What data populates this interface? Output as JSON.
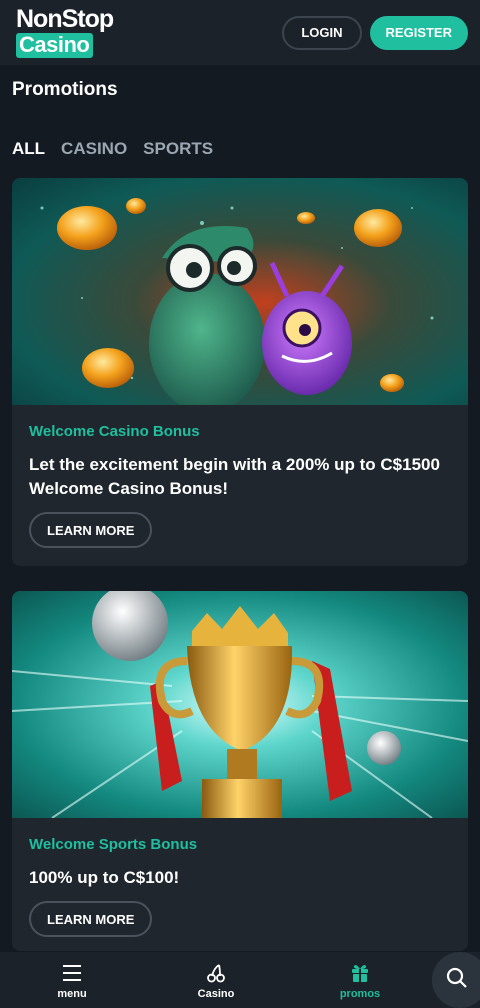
{
  "header": {
    "logo_top": "NonStop",
    "logo_bottom": "Casino",
    "login_label": "LOGIN",
    "register_label": "REGISTER"
  },
  "page": {
    "title": "Promotions"
  },
  "tabs": [
    {
      "label": "ALL",
      "active": true
    },
    {
      "label": "CASINO",
      "active": false
    },
    {
      "label": "SPORTS",
      "active": false
    }
  ],
  "promos": [
    {
      "category": "Welcome Casino Bonus",
      "text": "Let the excitement begin with a 200% up to C$1500 Welcome Casino Bonus!",
      "button_label": "LEARN MORE",
      "image": "alien-characters-with-coins"
    },
    {
      "category": "Welcome Sports Bonus",
      "text": "100% up to C$100!",
      "button_label": "LEARN MORE",
      "image": "golden-trophy-with-footballs"
    }
  ],
  "bottom_nav": {
    "items": [
      {
        "label": "menu",
        "icon": "hamburger-icon",
        "active": false
      },
      {
        "label": "Casino",
        "icon": "cherries-icon",
        "active": false
      },
      {
        "label": "promos",
        "icon": "gift-icon",
        "active": true
      }
    ],
    "search_icon": "search-icon"
  },
  "colors": {
    "accent": "#1fbf9f",
    "background": "#141a21",
    "header": "#1b2229",
    "card": "#1f262d",
    "inactive_tab": "#9aa6b2"
  }
}
